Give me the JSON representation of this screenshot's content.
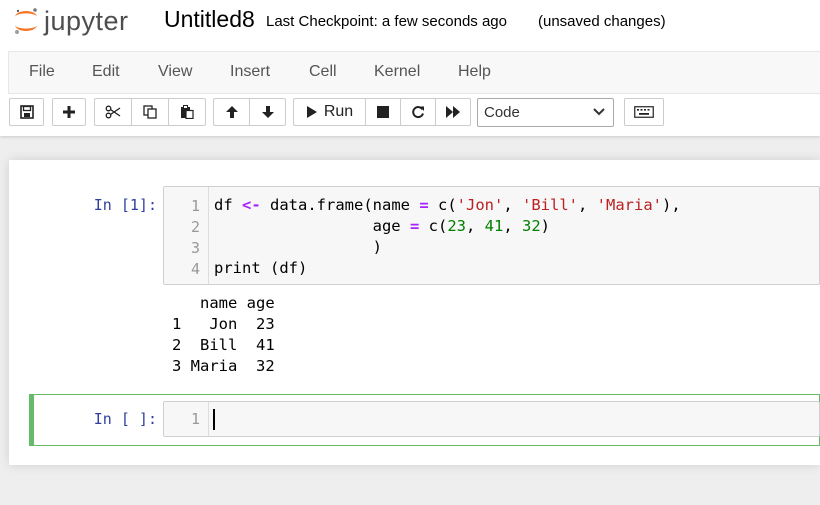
{
  "header": {
    "logo_text": "jupyter",
    "notebook_name": "Untitled8",
    "checkpoint": "Last Checkpoint: a few seconds ago",
    "autosave_status": "(unsaved changes)"
  },
  "menu": [
    "File",
    "Edit",
    "View",
    "Insert",
    "Cell",
    "Kernel",
    "Help"
  ],
  "toolbar": {
    "icons": [
      "save-icon",
      "plus-icon",
      "scissors-icon",
      "copy-icon",
      "paste-icon",
      "arrow-up-icon",
      "arrow-down-icon",
      "play-icon",
      "stop-icon",
      "restart-icon",
      "fast-forward-icon",
      "keyboard-icon"
    ],
    "run_label": "Run",
    "cell_type": "Code"
  },
  "cells": [
    {
      "prompt": "In [1]:",
      "line_numbers": [
        "1",
        "2",
        "3",
        "4"
      ],
      "code": [
        "df <- data.frame(name = c('Jon', 'Bill', 'Maria'),",
        "                 age = c(23, 41, 32)",
        "                 )",
        "print (df)"
      ],
      "output": [
        "   name age",
        "1   Jon  23",
        "2  Bill  41",
        "3 Maria  32"
      ]
    },
    {
      "prompt": "In [ ]:",
      "line_numbers": [
        "1"
      ],
      "code": [
        ""
      ]
    }
  ],
  "colors": {
    "prompt": "#303f9f",
    "active_cell_border": "#66bb6a",
    "operator": "#aa22ff",
    "string": "#ba2121",
    "number": "#008000"
  }
}
